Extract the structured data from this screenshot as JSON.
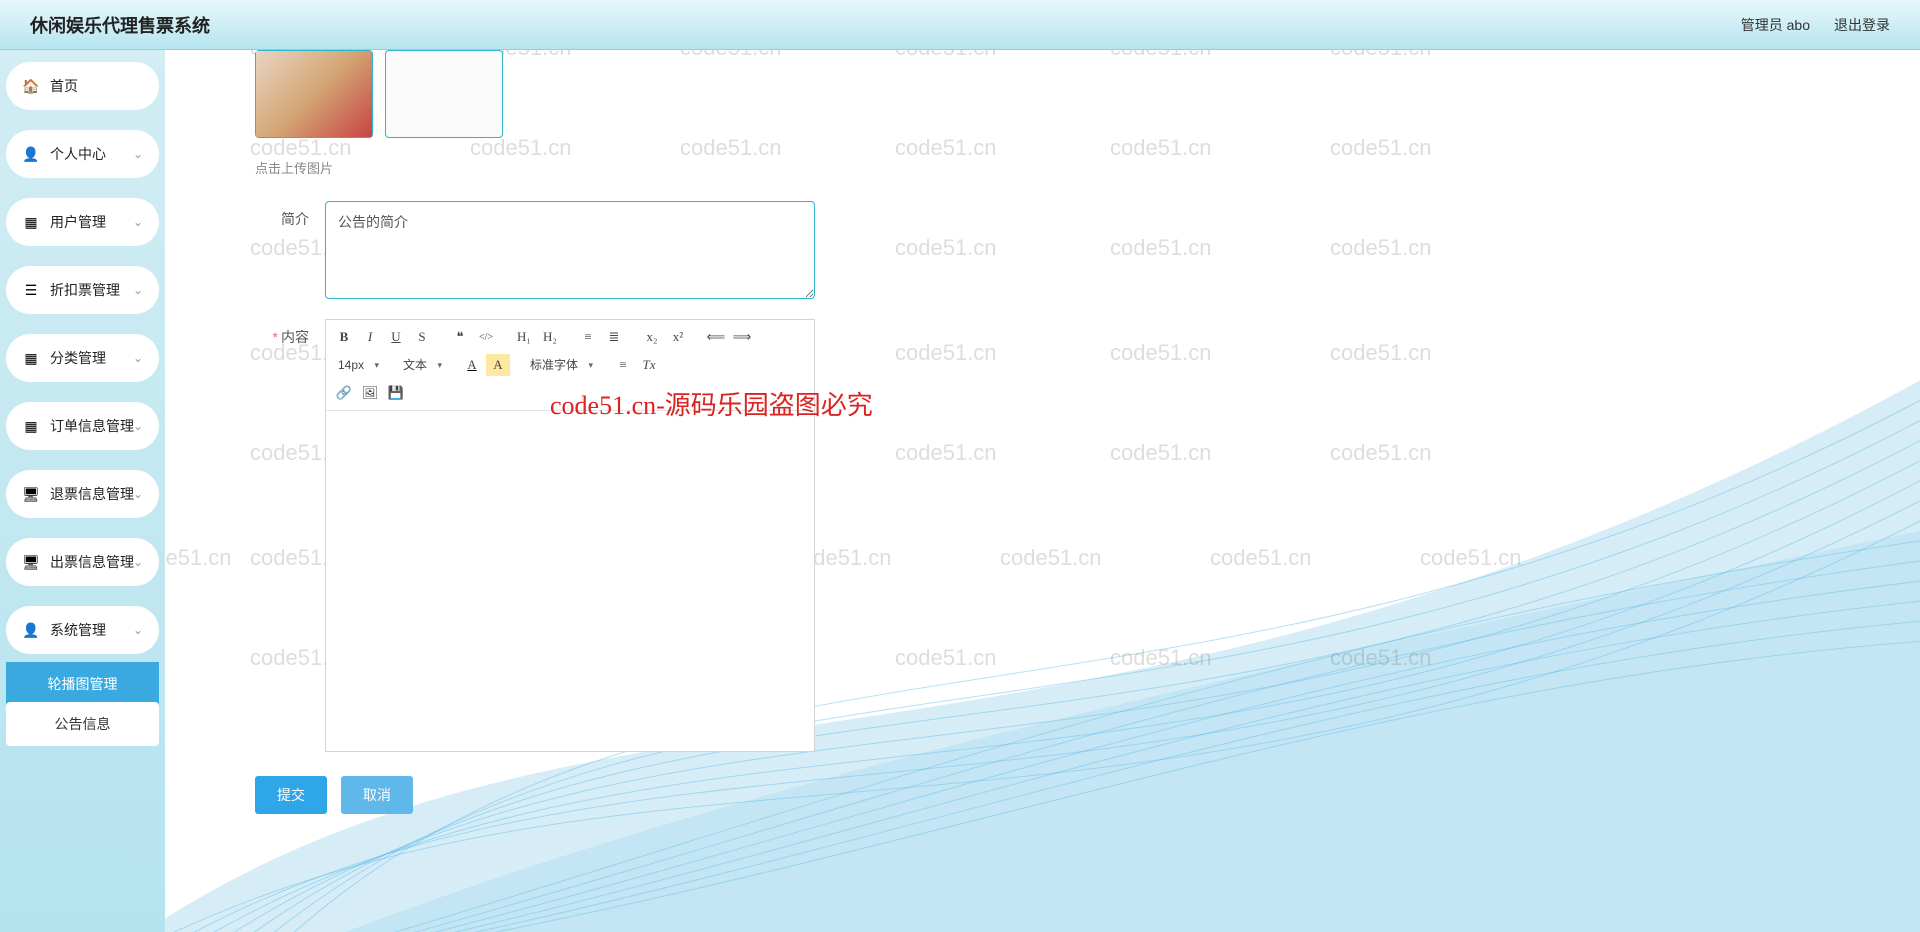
{
  "header": {
    "title": "休闲娱乐代理售票系统",
    "admin_label": "管理员 abo",
    "logout_label": "退出登录"
  },
  "sidebar": {
    "items": [
      {
        "label": "首页",
        "icon": "home",
        "expandable": false
      },
      {
        "label": "个人中心",
        "icon": "user",
        "expandable": true
      },
      {
        "label": "用户管理",
        "icon": "grid",
        "expandable": true
      },
      {
        "label": "折扣票管理",
        "icon": "bars",
        "expandable": true
      },
      {
        "label": "分类管理",
        "icon": "grid",
        "expandable": true
      },
      {
        "label": "订单信息管理",
        "icon": "grid",
        "expandable": true
      },
      {
        "label": "退票信息管理",
        "icon": "monitor",
        "expandable": true
      },
      {
        "label": "出票信息管理",
        "icon": "monitor",
        "expandable": true
      },
      {
        "label": "系统管理",
        "icon": "user",
        "expandable": true
      }
    ],
    "sub_active": "轮播图管理",
    "sub_other": "公告信息"
  },
  "form": {
    "upload_hint": "点击上传图片",
    "intro_label": "简介",
    "intro_value": "公告的简介",
    "content_label": "内容",
    "content_required": "*"
  },
  "editor": {
    "font_size": "14px",
    "font_style": "文本",
    "font_family": "标准字体",
    "buttons_r1": [
      "B",
      "I",
      "U",
      "S",
      "❝",
      "</>",
      "H₁",
      "H₂",
      "≡",
      "≣",
      "x₂",
      "x²",
      "⟸",
      "⟹"
    ],
    "buttons_r2_end": [
      "A",
      "A",
      "≡",
      "Tx"
    ],
    "buttons_r3": [
      "🔗",
      "🖼",
      "💾"
    ]
  },
  "buttons": {
    "submit": "提交",
    "cancel": "取消"
  },
  "watermark": {
    "text": "code51.cn",
    "big": "code51.cn-源码乐园盗图必究"
  }
}
